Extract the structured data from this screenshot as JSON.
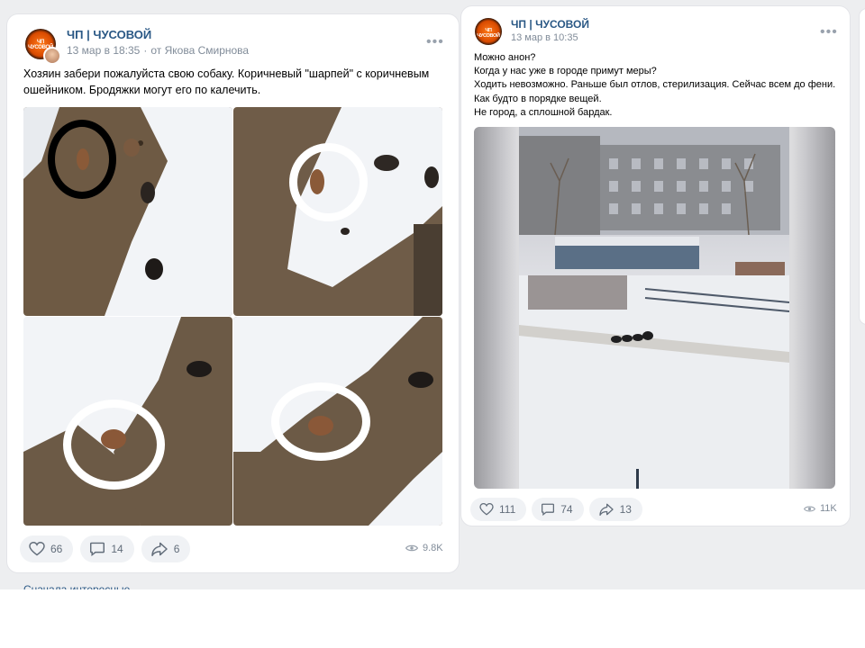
{
  "post1": {
    "author": "ЧП | ЧУСОВОЙ",
    "date": "13 мар в 18:35",
    "from": "от Якова Смирнова",
    "text": "Хозяин забери пожалуйста свою собаку. Коричневый \"шарпей\" с коричневым ошейником. Бродяжки могут его по калечить.",
    "likes": "66",
    "comments": "14",
    "shares": "6",
    "views": "9.8K",
    "cut_text": "Сначала интересные"
  },
  "post2": {
    "author": "ЧП | ЧУСОВОЙ",
    "date": "13 мар в 10:35",
    "text_lines": [
      "Можно анон?",
      "Когда у нас уже в городе примут меры?",
      "Ходить невозможно. Раньше был отлов, стерилизация. Сейчас всем до фени.",
      "Как будто в порядке вещей.",
      "Не город, а сплошной бардак."
    ],
    "likes": "111",
    "comments": "74",
    "shares": "13",
    "views": "11K"
  },
  "avatar_text": "ЧП ЧУСОВОЙ",
  "icons": [
    "heart-icon",
    "comment-icon",
    "share-icon",
    "eye-icon",
    "more-icon"
  ],
  "colors": {
    "link": "#2a5885",
    "meta": "#818c99",
    "pill_bg": "#f0f2f5",
    "page_bg": "#edeef0"
  }
}
